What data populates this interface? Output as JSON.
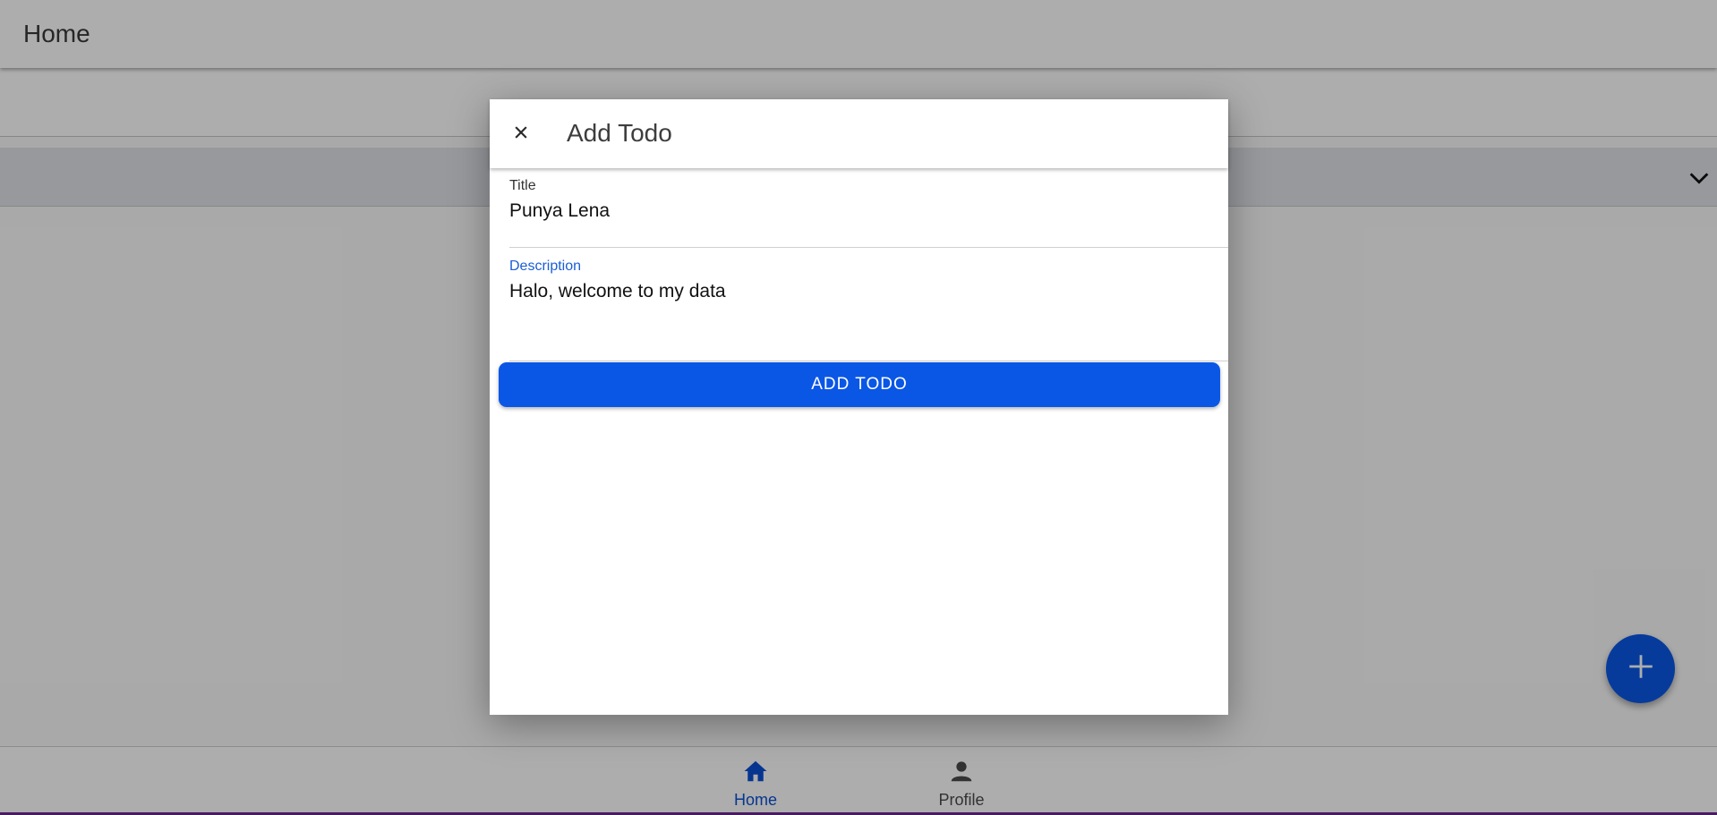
{
  "app": {
    "header": {
      "title": "Home"
    },
    "bottom_nav": {
      "items": [
        {
          "label": "Home",
          "icon": "home-icon",
          "active": true
        },
        {
          "label": "Profile",
          "icon": "person-icon",
          "active": false
        }
      ]
    },
    "fab": {
      "icon": "plus-icon"
    },
    "colors": {
      "accent": "#0a57e6",
      "active_nav": "#0a4fd4",
      "label_focus": "#1a5ed6"
    }
  },
  "modal": {
    "title": "Add Todo",
    "close_icon": "close-icon",
    "fields": {
      "title": {
        "label": "Title",
        "value": "Punya Lena"
      },
      "description": {
        "label": "Description",
        "value": "Halo, welcome to my data"
      }
    },
    "submit_label": "ADD TODO"
  }
}
